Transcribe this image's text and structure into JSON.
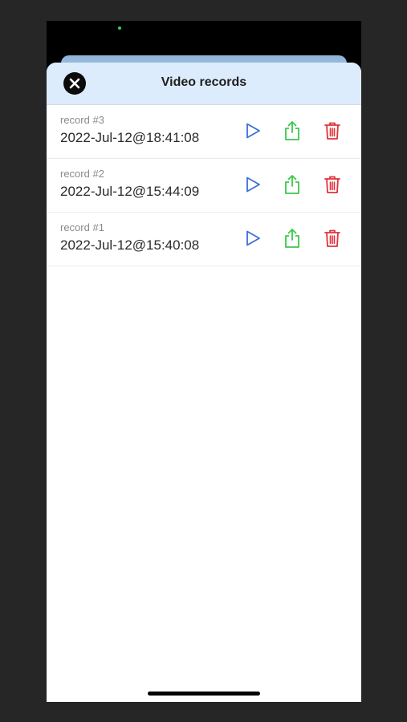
{
  "sheet": {
    "title": "Video records",
    "close_icon": "close-icon"
  },
  "records": [
    {
      "name": "record #3",
      "date": "2022-Jul-12@18:41:08"
    },
    {
      "name": "record #2",
      "date": "2022-Jul-12@15:44:09"
    },
    {
      "name": "record #1",
      "date": "2022-Jul-12@15:40:08"
    }
  ],
  "actions": {
    "play_icon": "play-icon",
    "share_icon": "share-icon",
    "delete_icon": "trash-icon"
  },
  "colors": {
    "header_bg": "#dcecfc",
    "play": "#3a6fd8",
    "share": "#3cc84a",
    "delete": "#e0323a"
  }
}
